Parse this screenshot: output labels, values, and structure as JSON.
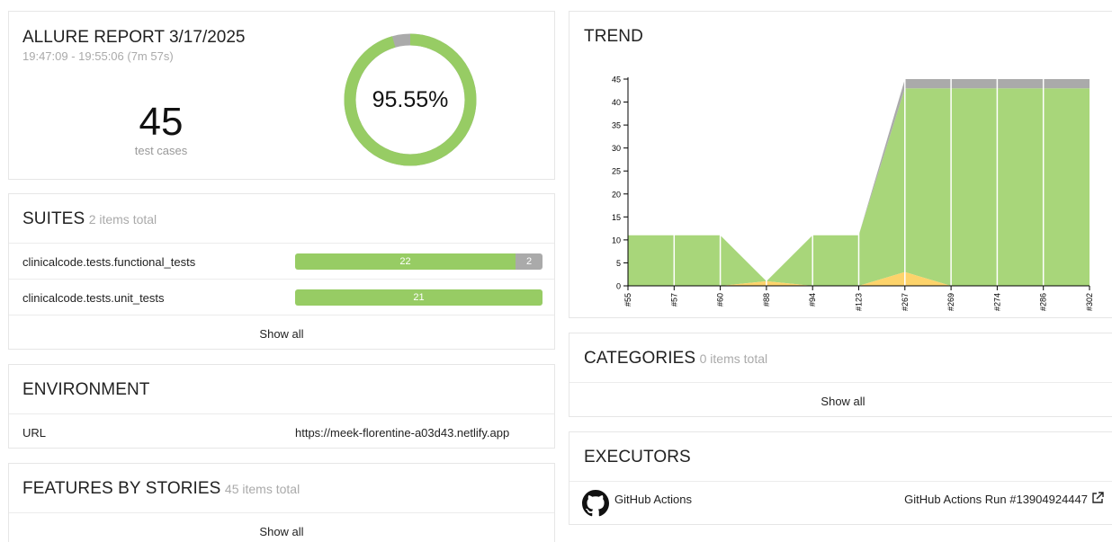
{
  "summary": {
    "title": "ALLURE REPORT 3/17/2025",
    "time_range": "19:47:09 - 19:55:06 (7m 57s)",
    "total": "45",
    "total_label": "test cases",
    "pass_percent": "95.55%",
    "pass_fraction": 0.9555
  },
  "suites": {
    "title": "SUITES",
    "count_label": "2 items total",
    "items": [
      {
        "name": "clinicalcode.tests.functional_tests",
        "passed": "22",
        "skipped": "2"
      },
      {
        "name": "clinicalcode.tests.unit_tests",
        "passed": "21"
      }
    ],
    "show_all": "Show all"
  },
  "environment": {
    "title": "ENVIRONMENT",
    "rows": [
      {
        "key": "URL",
        "value": "https://meek-florentine-a03d43.netlify.app"
      }
    ]
  },
  "features": {
    "title": "FEATURES BY STORIES",
    "count_label": "45 items total",
    "show_all": "Show all"
  },
  "trend": {
    "title": "TREND",
    "chart_data": {
      "type": "area",
      "categories": [
        "#55",
        "#57",
        "#60",
        "#88",
        "#94",
        "#123",
        "#267",
        "#269",
        "#274",
        "#286",
        "#302"
      ],
      "series": [
        {
          "name": "broken",
          "color": "#fdd36b",
          "values": [
            0,
            0,
            0,
            1,
            0,
            0,
            3,
            0,
            0,
            0,
            0
          ]
        },
        {
          "name": "passed",
          "color": "#a8d67a",
          "values": [
            11,
            11,
            11,
            0,
            11,
            11,
            40,
            43,
            43,
            43,
            43
          ]
        },
        {
          "name": "skipped",
          "color": "#aaaaaa",
          "values": [
            0,
            0,
            0,
            0,
            0,
            0,
            2,
            2,
            2,
            2,
            2
          ]
        }
      ],
      "y_ticks": [
        0,
        5,
        10,
        15,
        20,
        25,
        30,
        35,
        40,
        45
      ],
      "ylim": [
        0,
        45
      ]
    }
  },
  "categories": {
    "title": "CATEGORIES",
    "count_label": "0 items total",
    "show_all": "Show all"
  },
  "executors": {
    "title": "EXECUTORS",
    "name": "GitHub Actions",
    "icon": "github-icon",
    "run_label": "GitHub Actions Run #13904924447"
  },
  "colors": {
    "passed": "#97cc64",
    "skipped": "#aaaaaa",
    "broken": "#fdd36b"
  }
}
